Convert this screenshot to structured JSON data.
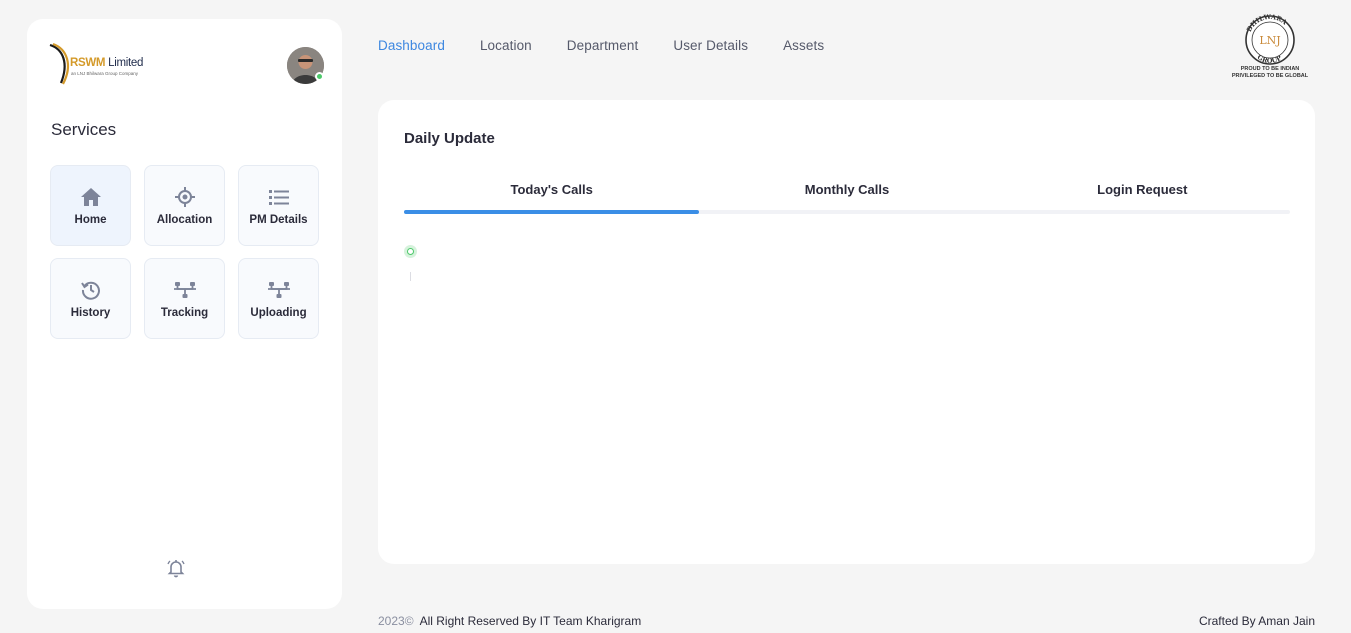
{
  "brand": {
    "name_prefix": "RSWM",
    "name_suffix": " Limited",
    "subtitle": "an LNJ Bhilwara Group Company"
  },
  "sidebar": {
    "services_title": "Services",
    "tiles": [
      {
        "label": "Home",
        "icon": "home-icon"
      },
      {
        "label": "Allocation",
        "icon": "crosshair-icon"
      },
      {
        "label": "PM Details",
        "icon": "list-icon"
      },
      {
        "label": "History",
        "icon": "history-icon"
      },
      {
        "label": "Tracking",
        "icon": "network-icon"
      },
      {
        "label": "Uploading",
        "icon": "network-icon"
      }
    ],
    "notification_icon": "bell-icon"
  },
  "nav": {
    "items": [
      "Dashboard",
      "Location",
      "Department",
      "User Details",
      "Assets"
    ],
    "active": "Dashboard"
  },
  "group_logo": {
    "text_top": "BHILWARA",
    "text_bottom": "GROUP",
    "monogram": "LNJ",
    "tag_line1": "PROUD TO BE INDIAN",
    "tag_line2": "PRIVILEGED TO BE GLOBAL"
  },
  "card": {
    "title": "Daily Update",
    "tabs": [
      "Today's Calls",
      "Monthly Calls",
      "Login Request"
    ],
    "active_tab": "Today's Calls"
  },
  "footer": {
    "year": "2023©",
    "rights": "All Right Reserved By IT Team Kharigram",
    "credit": "Crafted By Aman Jain"
  },
  "colors": {
    "accent": "#3d87e0",
    "tab_indicator": "#3a8ee6",
    "online": "#4cc96a",
    "background": "#f5f5f5"
  }
}
